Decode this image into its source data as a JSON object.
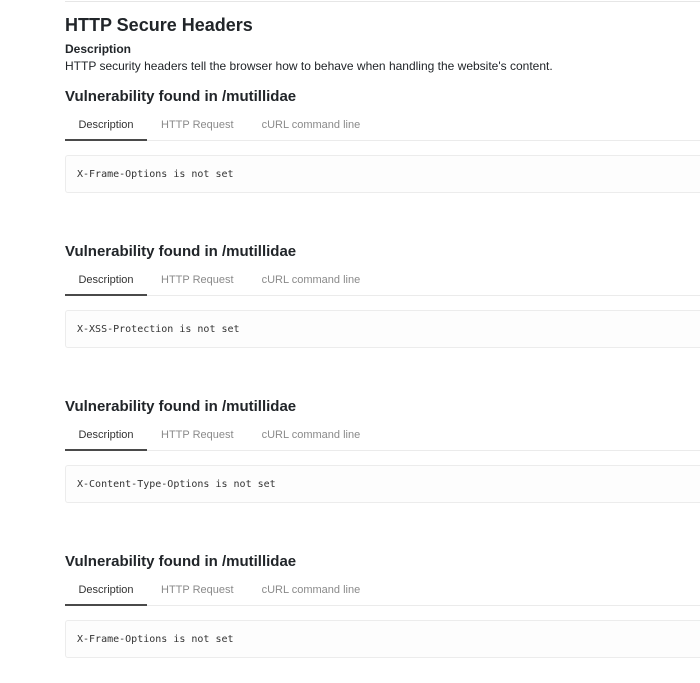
{
  "page": {
    "title": "HTTP Secure Headers",
    "description_heading": "Description",
    "description_text": "HTTP security headers tell the browser how to behave when handling the website's content."
  },
  "tab_labels": {
    "description": "Description",
    "http_request": "HTTP Request",
    "curl": "cURL command line"
  },
  "vulnerabilities": [
    {
      "title": "Vulnerability found in /mutillidae",
      "active_tab": "Description",
      "detail": "X-Frame-Options is not set"
    },
    {
      "title": "Vulnerability found in /mutillidae",
      "active_tab": "Description",
      "detail": "X-XSS-Protection is not set"
    },
    {
      "title": "Vulnerability found in /mutillidae",
      "active_tab": "Description",
      "detail": "X-Content-Type-Options is not set"
    },
    {
      "title": "Vulnerability found in /mutillidae",
      "active_tab": "Description",
      "detail": "X-Frame-Options is not set"
    }
  ]
}
